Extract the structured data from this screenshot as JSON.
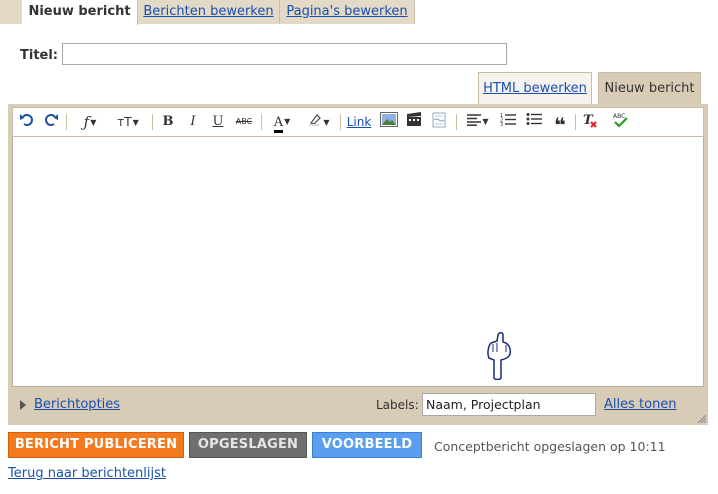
{
  "top_tabs": [
    {
      "label": "Nieuw bericht"
    },
    {
      "label": "Berichten bewerken"
    },
    {
      "label": "Pagina's bewerken"
    }
  ],
  "title": {
    "label": "Titel:",
    "value": ""
  },
  "mode_tabs": {
    "html": "HTML bewerken",
    "compose": "Nieuw bericht"
  },
  "toolbar": {
    "bold": "B",
    "italic": "I",
    "underline": "U",
    "strike": "ABC",
    "font_size": "тT",
    "text_color": "A",
    "link": "Link",
    "spell": "ABC"
  },
  "bottom": {
    "options_label": "Berichtopties",
    "labels_label": "Labels:",
    "labels_value": "Naam, Projectplan",
    "show_all": "Alles tonen"
  },
  "buttons": {
    "publish": "BERICHT PUBLICEREN",
    "save": "OPGESLAGEN",
    "preview": "VOORBEELD"
  },
  "status": "Conceptbericht opgeslagen op 10:11",
  "back_link": "Terug naar berichtenlijst",
  "colors": {
    "publish": "#f47a20",
    "save": "#6f6f6f",
    "preview": "#5a9ef0",
    "frame": "#d9ccb6",
    "link": "#1a4fb0"
  }
}
